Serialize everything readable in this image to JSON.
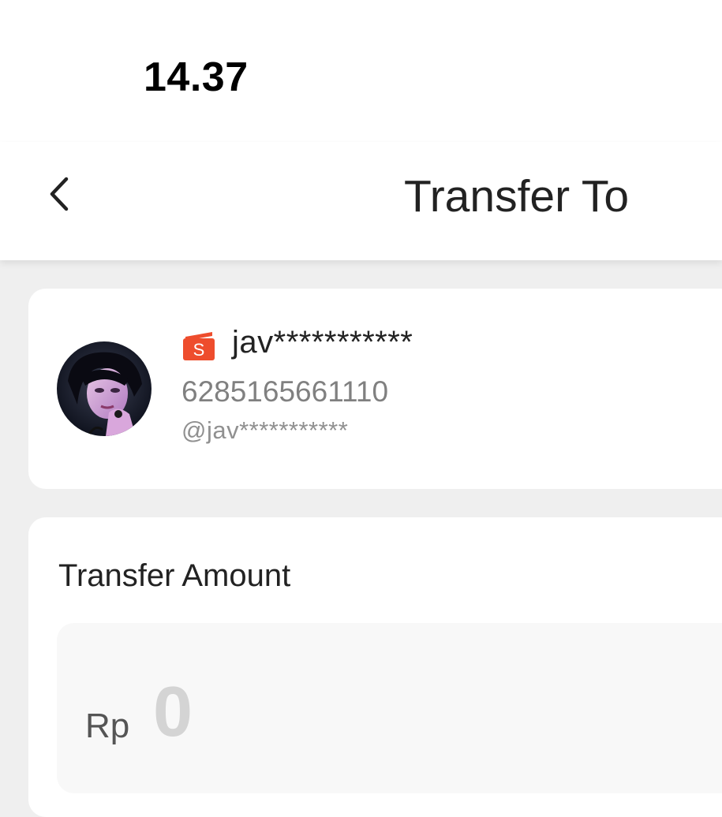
{
  "status_bar": {
    "time": "14.37"
  },
  "header": {
    "back_icon": "chevron-left-icon",
    "title": "Transfer To"
  },
  "recipient": {
    "shop_icon": "shopee-s-icon",
    "name": "jav***********",
    "phone": "6285165661110",
    "username": "@jav***********"
  },
  "amount": {
    "label": "Transfer Amount",
    "currency": "Rp",
    "value": "0"
  },
  "colors": {
    "brand_orange": "#ee4d2d",
    "background": "#efefef",
    "card": "#ffffff",
    "placeholder_gray": "#d4d4d4"
  }
}
